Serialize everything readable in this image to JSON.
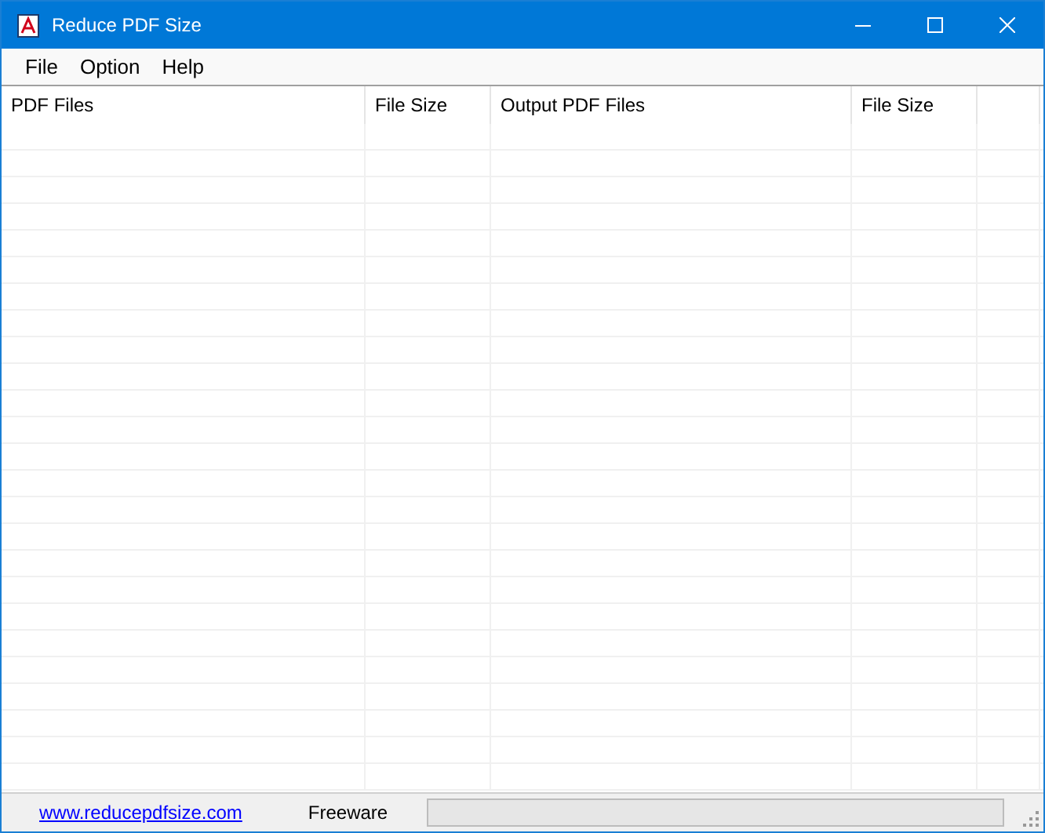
{
  "window": {
    "title": "Reduce PDF Size"
  },
  "menu": [
    "File",
    "Option",
    "Help"
  ],
  "table": {
    "columns": [
      "PDF Files",
      "File Size",
      "Output PDF Files",
      "File Size"
    ]
  },
  "status_bar": {
    "link": "www.reducepdfsize.com",
    "license": "Freeware",
    "progress": {
      "level": 0
    }
  }
}
